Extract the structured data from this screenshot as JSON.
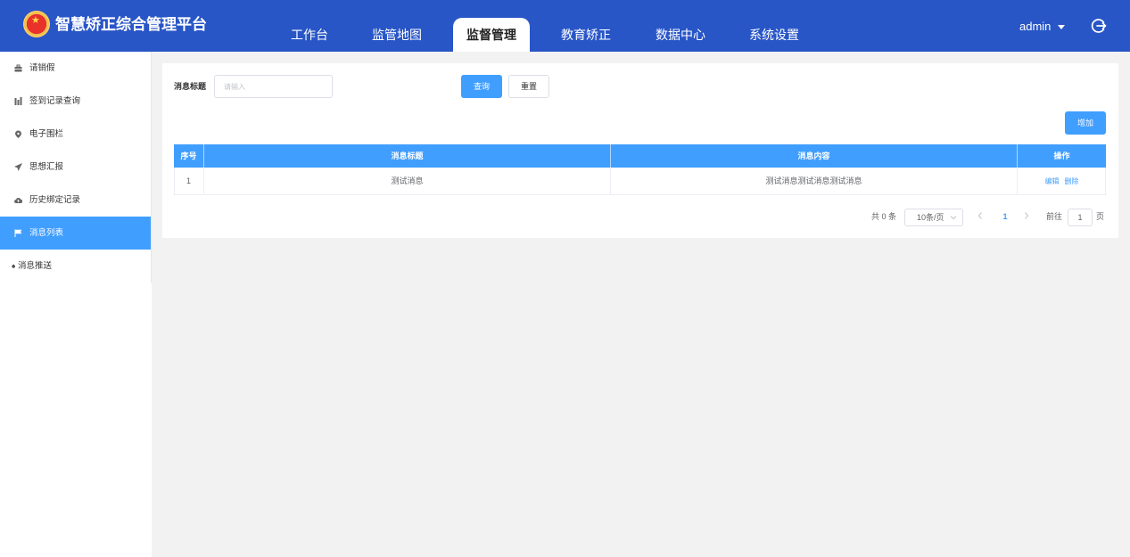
{
  "app": {
    "title": "智慧矫正综合管理平台"
  },
  "nav": {
    "tabs": [
      {
        "label": "工作台"
      },
      {
        "label": "监管地图"
      },
      {
        "label": "监督管理"
      },
      {
        "label": "教育矫正"
      },
      {
        "label": "数据中心"
      },
      {
        "label": "系统设置"
      }
    ],
    "active": "监督管理"
  },
  "user": {
    "name": "admin"
  },
  "sidebar": {
    "items": [
      {
        "label": "请销假",
        "icon": "briefcase-icon"
      },
      {
        "label": "签到记录查询",
        "icon": "bar-chart-icon"
      },
      {
        "label": "电子围栏",
        "icon": "map-pin-icon"
      },
      {
        "label": "思想汇报",
        "icon": "paper-plane-icon"
      },
      {
        "label": "历史绑定记录",
        "icon": "cloud-icon"
      },
      {
        "label": "消息列表",
        "icon": "flag-icon"
      },
      {
        "label": "消息推送",
        "icon": "spade-icon"
      }
    ],
    "active": "消息列表"
  },
  "search": {
    "label": "消息标题",
    "placeholder": "请输入",
    "value": "",
    "query_label": "查询",
    "reset_label": "重置"
  },
  "toolbar": {
    "add_label": "增加"
  },
  "table": {
    "columns": [
      "序号",
      "消息标题",
      "消息内容",
      "操作"
    ],
    "rows": [
      {
        "index": "1",
        "title": "测试消息",
        "content": "测试消息测试消息测试消息",
        "actions": [
          "编辑",
          "删除"
        ]
      }
    ]
  },
  "pagination": {
    "total_text": "共 0 条",
    "page_size": "10条/页",
    "current_page": "1",
    "goto_label": "前往",
    "goto_value": "1",
    "page_suffix": "页"
  },
  "colors": {
    "header_bg": "#2856c7",
    "primary": "#409eff",
    "content_bg": "#f2f2f2"
  }
}
